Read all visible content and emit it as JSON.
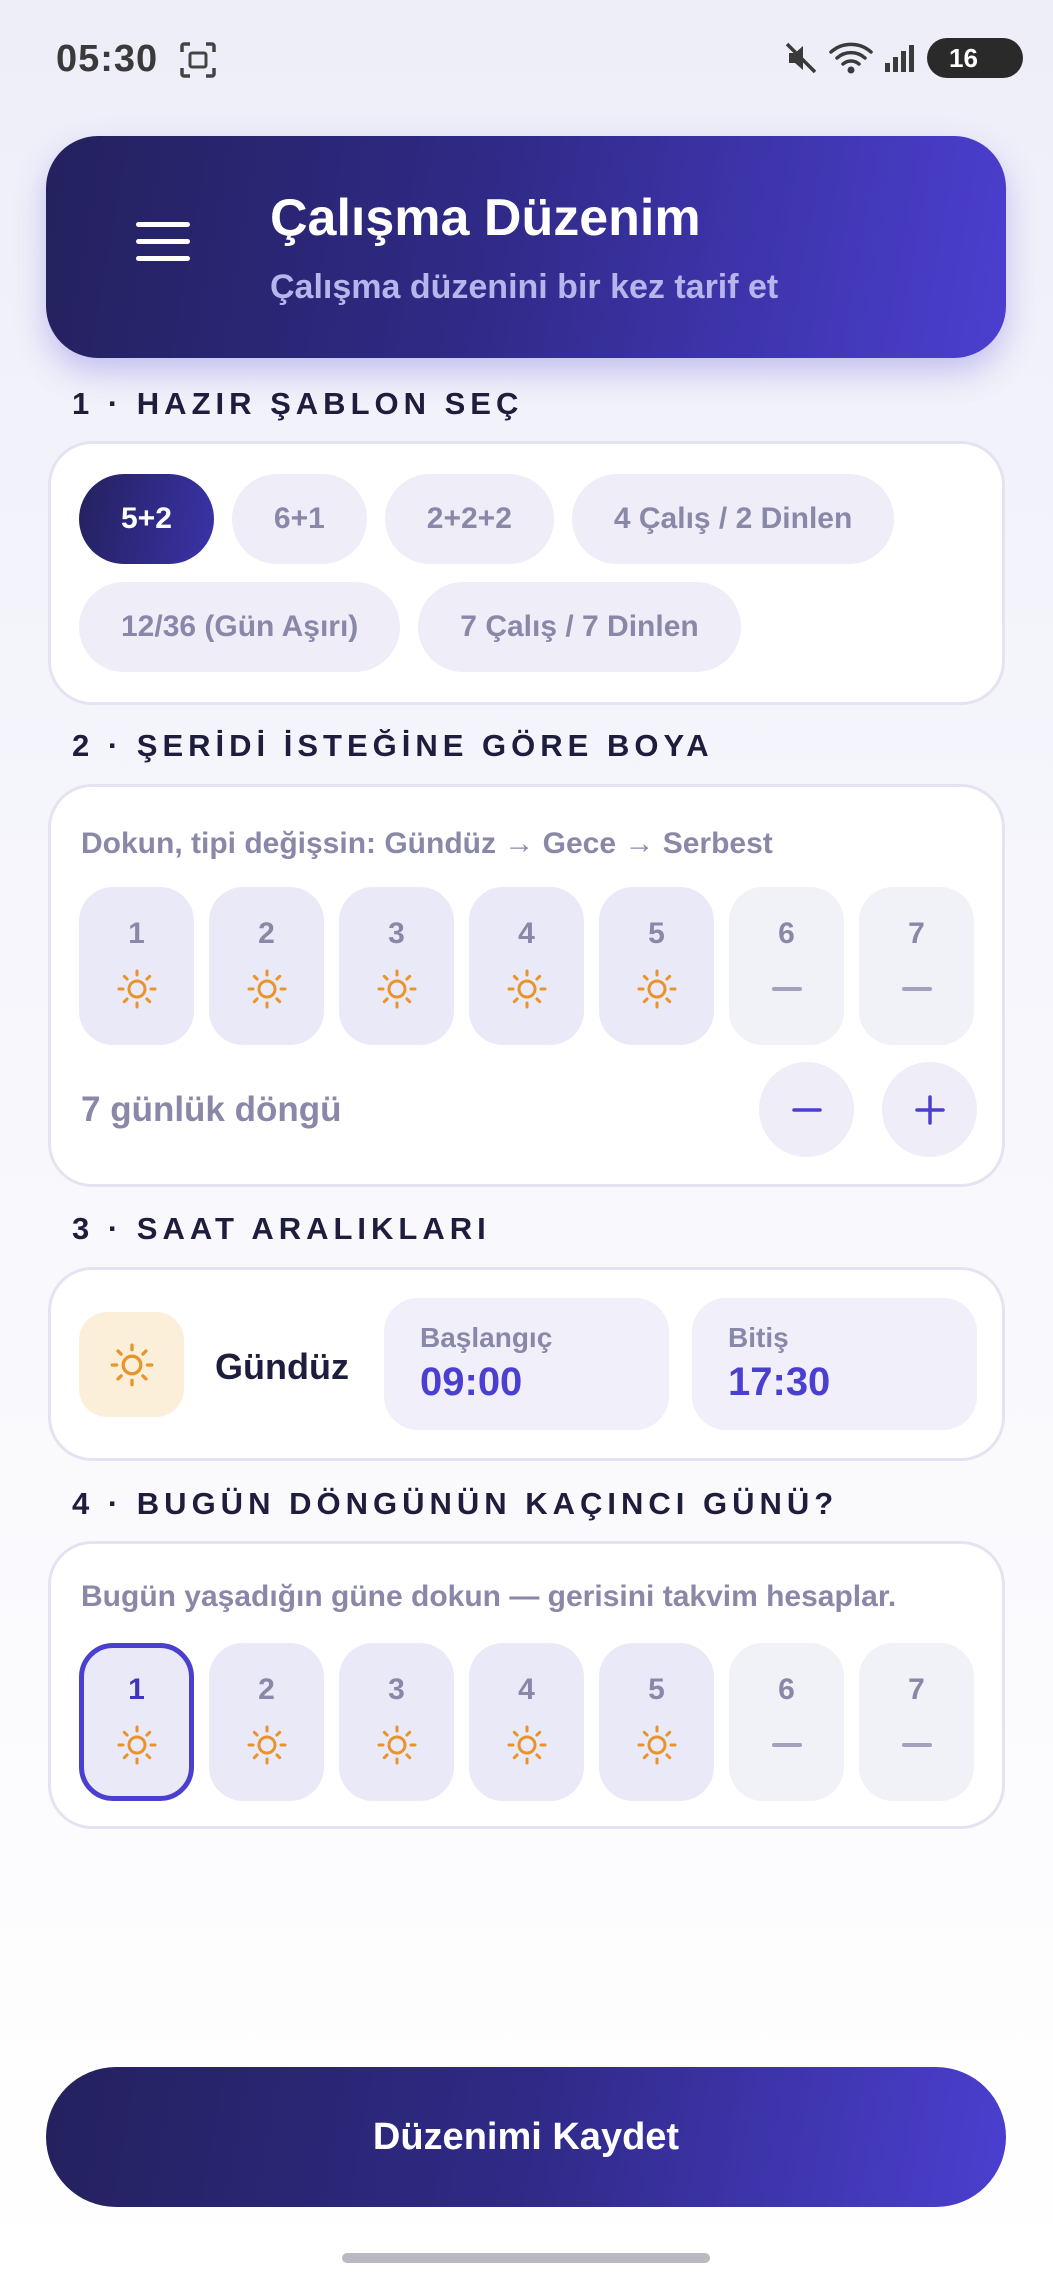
{
  "status_bar": {
    "time": "05:30",
    "battery": "16",
    "icons": [
      "screenshot-icon",
      "mute-icon",
      "wifi-icon",
      "signal-icon",
      "battery-icon"
    ]
  },
  "header": {
    "title": "Çalışma Düzenim",
    "subtitle": "Çalışma düzenini bir kez tarif et",
    "menu_icon": "hamburger-menu-icon"
  },
  "sections": {
    "templates": {
      "heading": "1 · HAZIR ŞABLON SEÇ",
      "selected": "5+2",
      "chips": [
        {
          "label": "5+2",
          "active": true
        },
        {
          "label": "6+1",
          "active": false
        },
        {
          "label": "2+2+2",
          "active": false
        },
        {
          "label": "4 Çalış / 2 Dinlen",
          "active": false
        },
        {
          "label": "12/36 (Gün Aşırı)",
          "active": false
        },
        {
          "label": "7 Çalış / 7 Dinlen",
          "active": false
        }
      ]
    },
    "strip": {
      "heading": "2 · ŞERİDİ İSTEĞİNE GÖRE BOYA",
      "helper": "Dokun, tipi değişsin: Gündüz → Gece → Serbest",
      "days": [
        {
          "num": "1",
          "type": "sun"
        },
        {
          "num": "2",
          "type": "sun"
        },
        {
          "num": "3",
          "type": "sun"
        },
        {
          "num": "4",
          "type": "sun"
        },
        {
          "num": "5",
          "type": "sun"
        },
        {
          "num": "6",
          "type": "off"
        },
        {
          "num": "7",
          "type": "off"
        }
      ],
      "cycle_label": "7 günlük döngü",
      "decrease_icon": "minus-icon",
      "increase_icon": "plus-icon"
    },
    "hours": {
      "heading": "3 · SAAT ARALIKLARI",
      "shift_name": "Gündüz",
      "shift_icon": "sun-icon",
      "start_label": "Başlangıç",
      "start_value": "09:00",
      "end_label": "Bitiş",
      "end_value": "17:30"
    },
    "today": {
      "heading": "4 · BUGÜN DÖNGÜNÜN KAÇINCI GÜNÜ?",
      "helper": "Bugün yaşadığın güne dokun — gerisini takvim hesaplar.",
      "selected_day": "1",
      "days": [
        {
          "num": "1",
          "type": "sun"
        },
        {
          "num": "2",
          "type": "sun"
        },
        {
          "num": "3",
          "type": "sun"
        },
        {
          "num": "4",
          "type": "sun"
        },
        {
          "num": "5",
          "type": "sun"
        },
        {
          "num": "6",
          "type": "off"
        },
        {
          "num": "7",
          "type": "off"
        }
      ]
    }
  },
  "save_button": "Düzenimi Kaydet",
  "colors": {
    "accent": "#4b3fd0",
    "header_dark": "#24215e",
    "sun": "#e8942a",
    "muted_text": "#8a88a8"
  }
}
